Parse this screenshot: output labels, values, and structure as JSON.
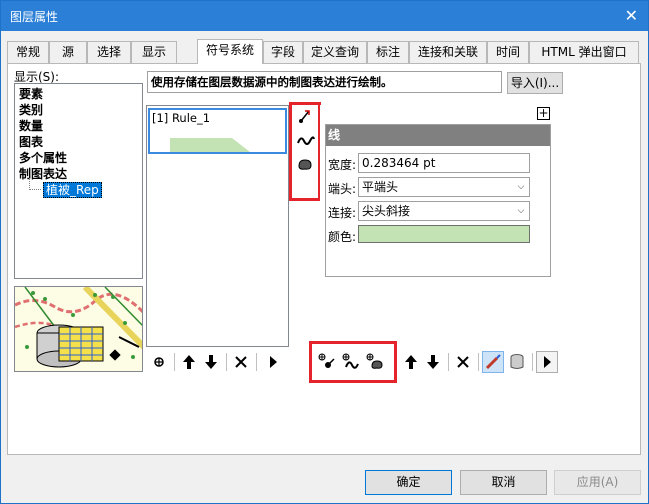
{
  "window": {
    "title": "图层属性",
    "close_glyph": "✕"
  },
  "tabs": [
    {
      "label": "常规"
    },
    {
      "label": "源"
    },
    {
      "label": "选择"
    },
    {
      "label": "显示"
    },
    {
      "label": "符号系统",
      "active": true
    },
    {
      "label": "字段"
    },
    {
      "label": "定义查询"
    },
    {
      "label": "标注"
    },
    {
      "label": "连接和关联"
    },
    {
      "label": "时间"
    },
    {
      "label": "HTML 弹出窗口"
    }
  ],
  "show_panel": {
    "label": "显示(S):",
    "items": [
      "要素",
      "类别",
      "数量",
      "图表",
      "多个属性",
      "制图表达"
    ],
    "selected_sub_item": "植被_Rep"
  },
  "description": "使用存储在图层数据源中的制图表达进行绘制。",
  "import_button": "导入(I)...",
  "rules": {
    "items": [
      {
        "label": "[1] Rule_1"
      }
    ]
  },
  "properties": {
    "header": "线",
    "width": {
      "label": "宽度:",
      "value": "0.283464 pt"
    },
    "cap": {
      "label": "端头:",
      "value": "平端头"
    },
    "join": {
      "label": "连接:",
      "value": "尖头斜接"
    },
    "color": {
      "label": "颜色:",
      "value": "#c4e3b4"
    }
  },
  "dialog_buttons": {
    "ok": "确定",
    "cancel": "取消",
    "apply": "应用(A)"
  },
  "colors": {
    "accent": "#2b7fd6",
    "highlight": "#e4232a",
    "fill_green": "#c4e3b4",
    "selection": "#0078d7"
  }
}
